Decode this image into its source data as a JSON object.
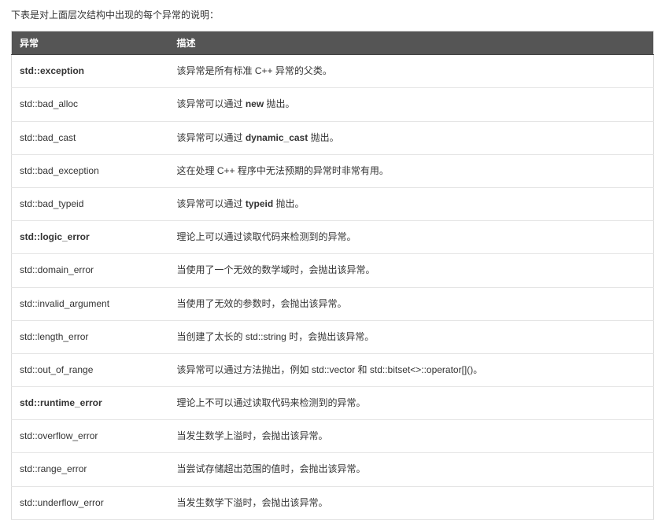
{
  "intro": "下表是对上面层次结构中出现的每个异常的说明：",
  "table": {
    "headers": {
      "exception": "异常",
      "description": "描述"
    },
    "rows": [
      {
        "name": "std::exception",
        "bold": true,
        "desc": [
          {
            "t": "该异常是所有标准 C++ 异常的父类。"
          }
        ]
      },
      {
        "name": "std::bad_alloc",
        "bold": false,
        "desc": [
          {
            "t": "该异常可以通过 "
          },
          {
            "t": "new",
            "b": true
          },
          {
            "t": " 抛出。"
          }
        ]
      },
      {
        "name": "std::bad_cast",
        "bold": false,
        "desc": [
          {
            "t": "该异常可以通过 "
          },
          {
            "t": "dynamic_cast",
            "b": true
          },
          {
            "t": " 抛出。"
          }
        ]
      },
      {
        "name": "std::bad_exception",
        "bold": false,
        "desc": [
          {
            "t": "这在处理 C++ 程序中无法预期的异常时非常有用。"
          }
        ]
      },
      {
        "name": "std::bad_typeid",
        "bold": false,
        "desc": [
          {
            "t": "该异常可以通过 "
          },
          {
            "t": "typeid",
            "b": true
          },
          {
            "t": " 抛出。"
          }
        ]
      },
      {
        "name": "std::logic_error",
        "bold": true,
        "desc": [
          {
            "t": "理论上可以通过读取代码来检测到的异常。"
          }
        ]
      },
      {
        "name": "std::domain_error",
        "bold": false,
        "desc": [
          {
            "t": "当使用了一个无效的数学域时，会抛出该异常。"
          }
        ]
      },
      {
        "name": "std::invalid_argument",
        "bold": false,
        "desc": [
          {
            "t": "当使用了无效的参数时，会抛出该异常。"
          }
        ]
      },
      {
        "name": "std::length_error",
        "bold": false,
        "desc": [
          {
            "t": "当创建了太长的 std::string 时，会抛出该异常。"
          }
        ]
      },
      {
        "name": "std::out_of_range",
        "bold": false,
        "desc": [
          {
            "t": "该异常可以通过方法抛出，例如 std::vector 和 std::bitset<>::operator[]()。"
          }
        ]
      },
      {
        "name": "std::runtime_error",
        "bold": true,
        "desc": [
          {
            "t": "理论上不可以通过读取代码来检测到的异常。"
          }
        ]
      },
      {
        "name": "std::overflow_error",
        "bold": false,
        "desc": [
          {
            "t": "当发生数学上溢时，会抛出该异常。"
          }
        ]
      },
      {
        "name": "std::range_error",
        "bold": false,
        "desc": [
          {
            "t": "当尝试存储超出范围的值时，会抛出该异常。"
          }
        ]
      },
      {
        "name": "std::underflow_error",
        "bold": false,
        "desc": [
          {
            "t": "当发生数学下溢时，会抛出该异常。"
          }
        ]
      }
    ]
  }
}
